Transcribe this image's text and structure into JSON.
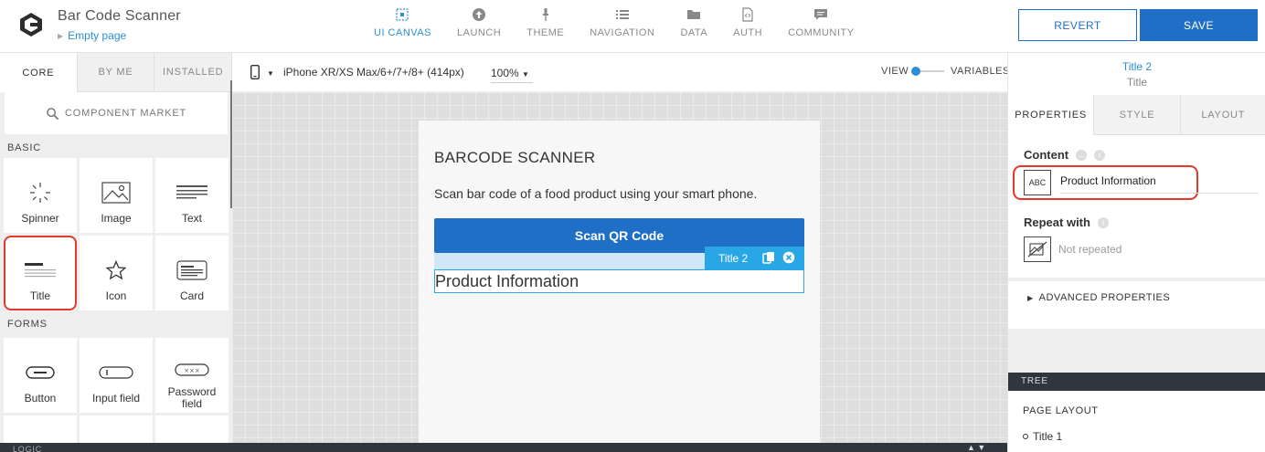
{
  "app": {
    "title": "Bar Code Scanner",
    "page_link": "Empty page"
  },
  "nav": {
    "items": [
      {
        "label": "UI CANVAS",
        "icon": "canvas-icon",
        "active": true
      },
      {
        "label": "LAUNCH",
        "icon": "launch-icon"
      },
      {
        "label": "THEME",
        "icon": "theme-icon"
      },
      {
        "label": "NAVIGATION",
        "icon": "navigation-icon"
      },
      {
        "label": "DATA",
        "icon": "folder-icon"
      },
      {
        "label": "AUTH",
        "icon": "auth-icon"
      },
      {
        "label": "COMMUNITY",
        "icon": "chat-icon"
      }
    ]
  },
  "actions": {
    "revert": "REVERT",
    "save": "SAVE"
  },
  "left_panel": {
    "tabs": [
      "CORE",
      "BY ME",
      "INSTALLED"
    ],
    "market": "COMPONENT MARKET",
    "sections": {
      "basic": "BASIC",
      "forms": "FORMS"
    },
    "basic_items": [
      "Spinner",
      "Image",
      "Text",
      "Title",
      "Icon",
      "Card"
    ],
    "form_items": [
      "Button",
      "Input field",
      "Password field"
    ]
  },
  "device_bar": {
    "device": "iPhone XR/XS Max/6+/7+/8+ (414px)",
    "zoom": "100%",
    "view": "VIEW",
    "variables": "VARIABLES"
  },
  "canvas": {
    "heading": "BARCODE SCANNER",
    "description": "Scan bar code of a food product using your smart phone.",
    "scan_button": "Scan QR Code",
    "selected_badge": "Title 2",
    "product_title": "Product Information"
  },
  "bottom_bar": {
    "logic": "LOGIC"
  },
  "right_panel": {
    "header_title": "Title 2",
    "header_sub": "Title",
    "tabs": [
      "PROPERTIES",
      "STYLE",
      "LAYOUT"
    ],
    "content_label": "Content",
    "content_value": "Product Information",
    "abc_label": "ABC",
    "repeat_label": "Repeat with",
    "repeat_value": "Not repeated",
    "advanced": "ADVANCED PROPERTIES",
    "tree": "TREE",
    "page_layout": "PAGE LAYOUT",
    "tree_item": "Title 1"
  },
  "colors": {
    "accent": "#1f6fc7",
    "link": "#2a8fd6",
    "highlight": "#e03b2c",
    "selection": "#29a6e6"
  }
}
